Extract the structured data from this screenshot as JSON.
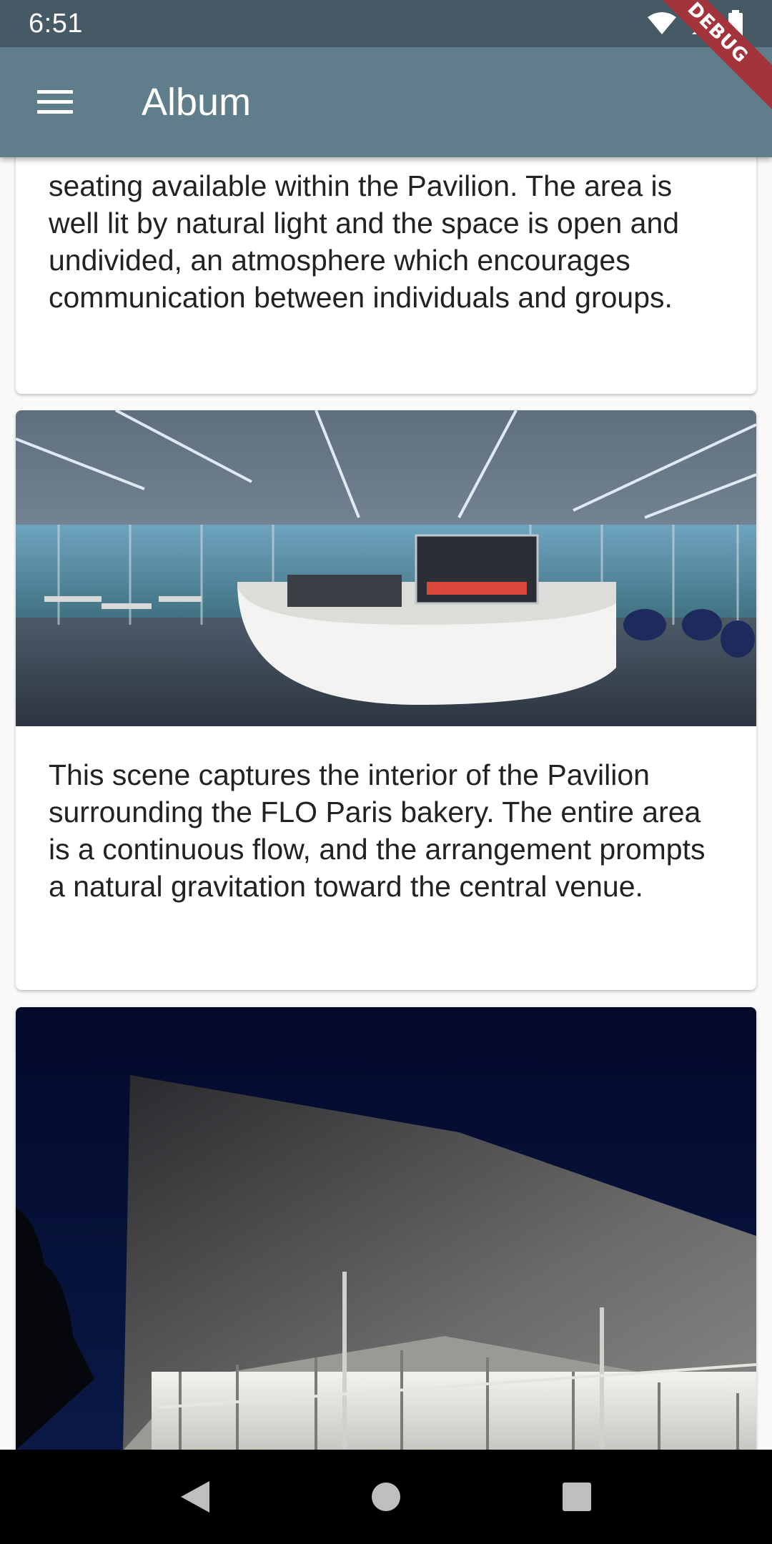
{
  "status": {
    "time": "6:51"
  },
  "debug_label": "DEBUG",
  "app_bar": {
    "title": "Album"
  },
  "cards": [
    {
      "text": "seating available within the Pavilion. The area is well lit by natural light and the space is open and undivided, an atmosphere which encourages communication between individuals and groups."
    },
    {
      "image": "pavilion-interior-bakery-photo",
      "text": "This scene captures the interior of the Pavilion surrounding the FLO Paris bakery. The entire area is a continuous flow, and the arrangement prompts a natural gravitation toward the central venue."
    },
    {
      "image": "pavilion-exterior-night-photo"
    }
  ],
  "nav": {
    "back": "back-icon",
    "home": "home-icon",
    "recents": "recents-icon"
  },
  "colors": {
    "app_bar": "#607d8b",
    "status_bar": "#455a64",
    "debug": "#a3343b"
  }
}
